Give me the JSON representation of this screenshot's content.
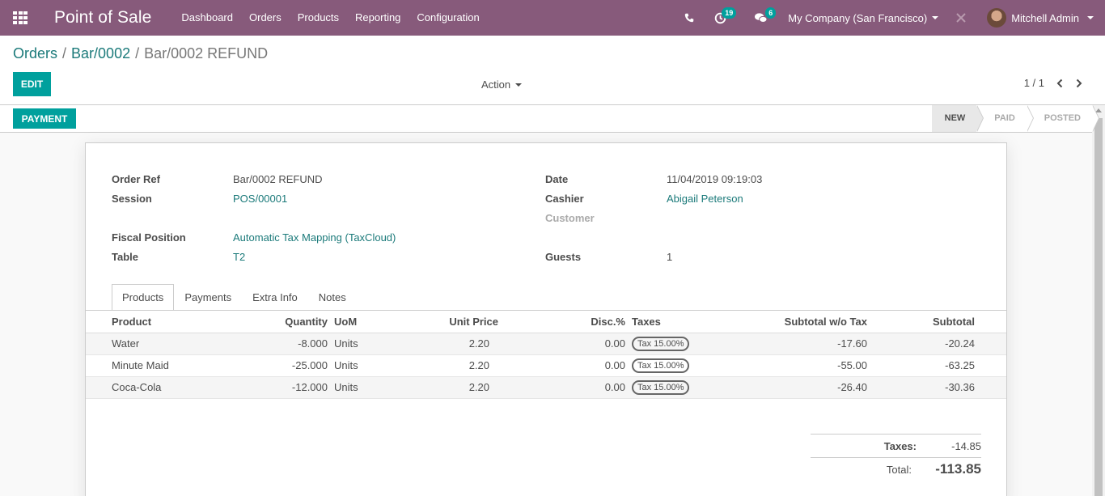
{
  "navbar": {
    "brand": "Point of Sale",
    "menu": [
      "Dashboard",
      "Orders",
      "Products",
      "Reporting",
      "Configuration"
    ],
    "activity_count": "19",
    "messages_count": "6",
    "company": "My Company (San Francisco)",
    "user": "Mitchell Admin"
  },
  "breadcrumb": {
    "root": "Orders",
    "parent": "Bar/0002",
    "current": "Bar/0002 REFUND"
  },
  "control": {
    "edit_label": "EDIT",
    "action_label": "Action",
    "pager": "1 / 1"
  },
  "statusbar": {
    "payment_label": "PAYMENT",
    "stages": [
      "NEW",
      "PAID",
      "POSTED"
    ],
    "active_stage": "NEW"
  },
  "form": {
    "order_ref_label": "Order Ref",
    "order_ref": "Bar/0002 REFUND",
    "session_label": "Session",
    "session": "POS/00001",
    "fiscal_position_label": "Fiscal Position",
    "fiscal_position": "Automatic Tax Mapping (TaxCloud)",
    "table_label": "Table",
    "table": "T2",
    "date_label": "Date",
    "date": "11/04/2019 09:19:03",
    "cashier_label": "Cashier",
    "cashier": "Abigail Peterson",
    "customer_label": "Customer",
    "guests_label": "Guests",
    "guests": "1"
  },
  "tabs": [
    "Products",
    "Payments",
    "Extra Info",
    "Notes"
  ],
  "lines": {
    "headers": {
      "product": "Product",
      "quantity": "Quantity",
      "uom": "UoM",
      "unit_price": "Unit Price",
      "discount": "Disc.%",
      "taxes": "Taxes",
      "subtotal_wo_tax": "Subtotal w/o Tax",
      "subtotal": "Subtotal"
    },
    "rows": [
      {
        "product": "Water",
        "quantity": "-8.000",
        "uom": "Units",
        "unit_price": "2.20",
        "discount": "0.00",
        "tax": "Tax 15.00%",
        "subtotal_wo_tax": "-17.60",
        "subtotal": "-20.24"
      },
      {
        "product": "Minute Maid",
        "quantity": "-25.000",
        "uom": "Units",
        "unit_price": "2.20",
        "discount": "0.00",
        "tax": "Tax 15.00%",
        "subtotal_wo_tax": "-55.00",
        "subtotal": "-63.25"
      },
      {
        "product": "Coca-Cola",
        "quantity": "-12.000",
        "uom": "Units",
        "unit_price": "2.20",
        "discount": "0.00",
        "tax": "Tax 15.00%",
        "subtotal_wo_tax": "-26.40",
        "subtotal": "-30.36"
      }
    ]
  },
  "totals": {
    "taxes_label": "Taxes:",
    "taxes": "-14.85",
    "total_label": "Total:",
    "total": "-113.85"
  },
  "colors": {
    "navbar": "#875a7b",
    "primary": "#00a09d",
    "link": "#1b7a7a"
  }
}
